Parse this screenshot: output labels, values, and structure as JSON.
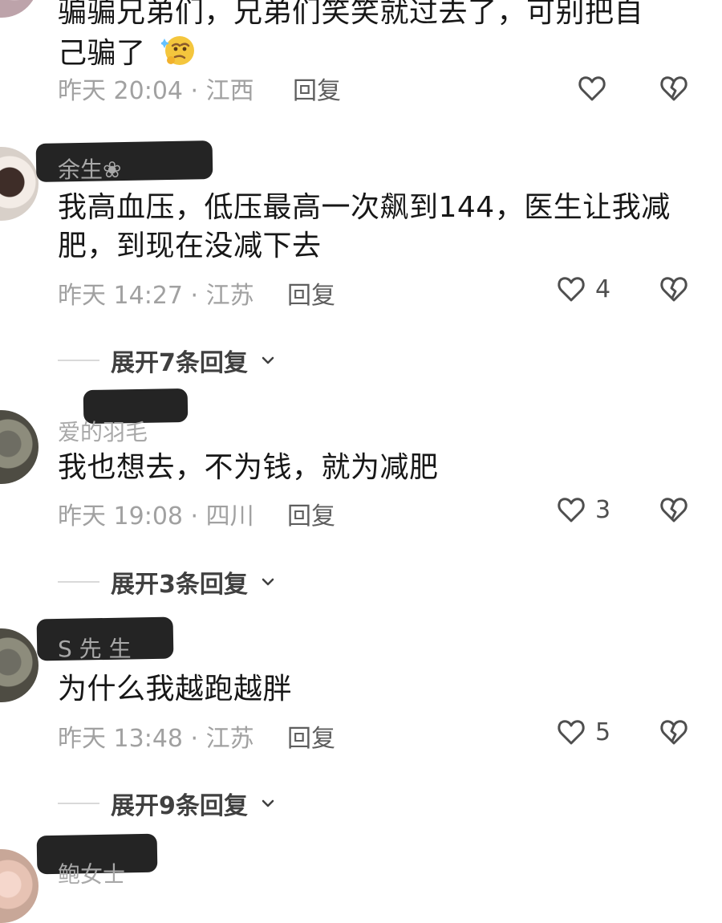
{
  "comments": [
    {
      "text_line_1": "骗骗兄弟们，兄弟们笑笑就过去了，可别把自",
      "text_line_2": "己骗了",
      "meta": "昨天 20:04 · 江西",
      "reply": "回复",
      "like_count": "",
      "avatar_icon": "avatar",
      "emoji_icon": "thinking-face-icon"
    },
    {
      "username": "余生❀",
      "text_line_1": "我高血压，低压最高一次飙到144，医生让我减",
      "text_line_2": "肥，到现在没减下去",
      "meta": "昨天 14:27 · 江苏",
      "reply": "回复",
      "like_count": "4",
      "expand": "展开7条回复"
    },
    {
      "username": "爱的羽毛",
      "text_line_1": "我也想去，不为钱，就为减肥",
      "meta": "昨天 19:08 · 四川",
      "reply": "回复",
      "like_count": "3",
      "expand": "展开3条回复"
    },
    {
      "username": "S 先 生",
      "text_line_1": "为什么我越跑越胖",
      "meta": "昨天 13:48 · 江苏",
      "reply": "回复",
      "like_count": "5",
      "expand": "展开9条回复"
    },
    {
      "username": "鲍女士"
    }
  ],
  "icons": {
    "like": "heart-icon",
    "dislike": "broken-heart-icon",
    "expand": "chevron-down-icon"
  }
}
